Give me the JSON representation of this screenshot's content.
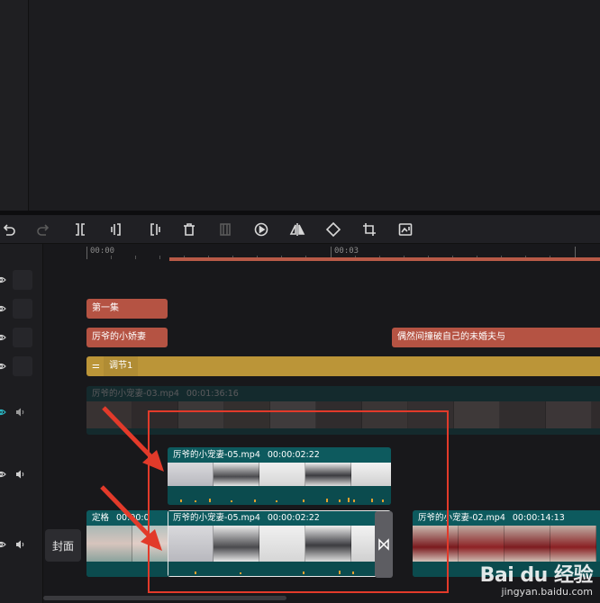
{
  "ruler": {
    "labels": [
      "00:00",
      "00:03"
    ]
  },
  "tracks": {
    "text1": {
      "label": "第一集"
    },
    "text2": {
      "label_a": "厉爷的小娇妻",
      "label_b": "偶然间撞破自己的未婚夫与"
    },
    "adjust": {
      "label": "调节1"
    },
    "ghost_clip": {
      "name": "厉爷的小宠妻-03.mp4",
      "duration": "00:01:36:16"
    },
    "drag_clip": {
      "name": "厉爷的小宠妻-05.mp4",
      "duration": "00:00:02:22"
    },
    "main": {
      "freeze_label": "定格",
      "freeze_time": "00:00:0",
      "freeze_time_b": "00",
      "selected_name": "厉爷的小宠妻-05.mp4",
      "selected_duration": "00:00:02:22",
      "next_name": "厉爷的小宠妻-02.mp4",
      "next_duration": "00:00:14:13"
    }
  },
  "cover_label": "封面",
  "watermark": {
    "logo": "Bai du 经验",
    "url": "jingyan.baidu.com"
  },
  "colors": {
    "text_clip": "#b55343",
    "adjust_clip": "#bb9538",
    "video_clip": "#0d5a5e",
    "highlight": "#e23a2a"
  }
}
